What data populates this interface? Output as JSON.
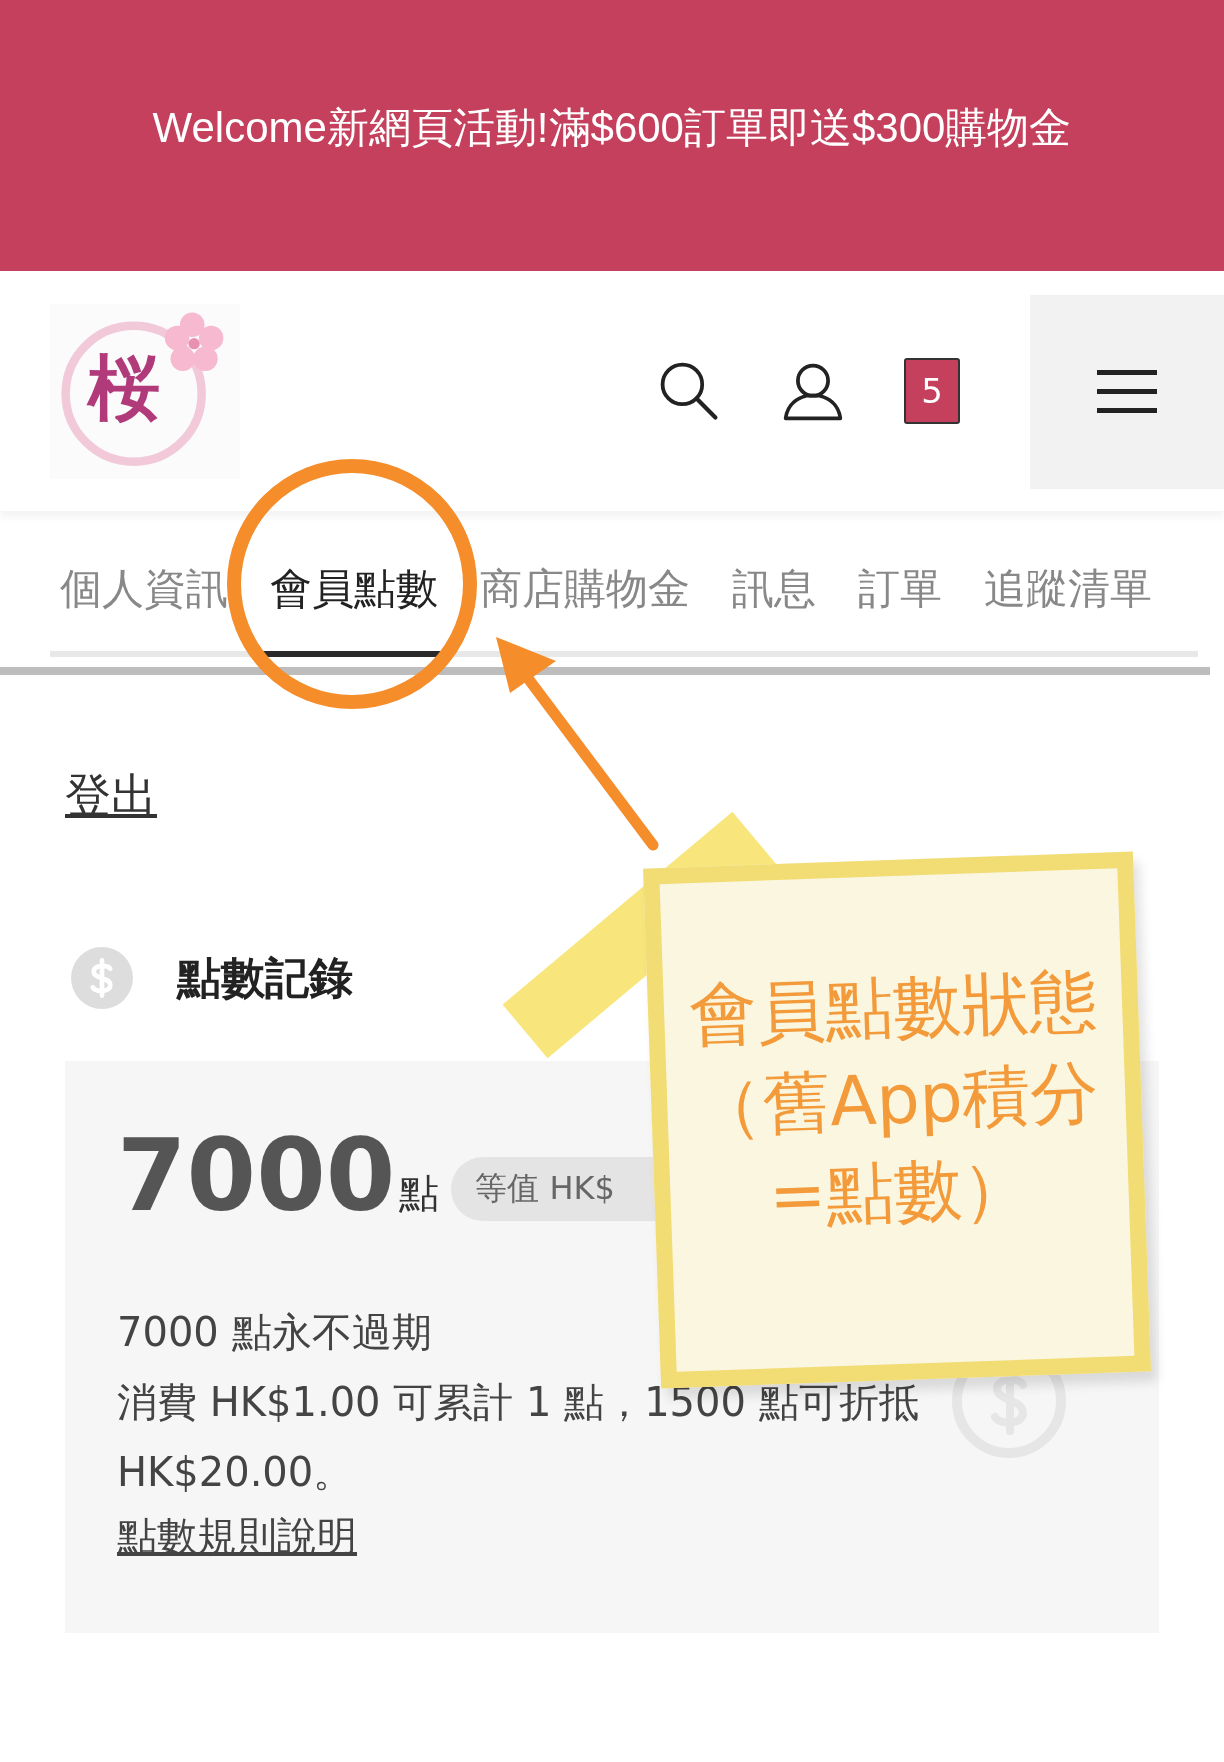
{
  "banner": {
    "text": "Welcome新網頁活動!滿$600訂單即送$300購物金"
  },
  "header": {
    "logo_text": "桜",
    "cart_count": "5"
  },
  "tabs": [
    {
      "label": "個人資訊",
      "selected": false
    },
    {
      "label": "會員點數",
      "selected": true
    },
    {
      "label": "商店購物金",
      "selected": false
    },
    {
      "label": "訊息",
      "selected": false
    },
    {
      "label": "訂單",
      "selected": false
    },
    {
      "label": "追蹤清單",
      "selected": false
    }
  ],
  "logout_link": "登出",
  "points_section": {
    "title": "點數記錄",
    "points": "7000",
    "unit": "點",
    "badge": "等值 HK$",
    "expiry": "7000 點永不過期",
    "rule_text": "消費 HK$1.00 可累計 1 點，1500 點可折抵 HK$20.00。",
    "rules_link": "點數規則說明"
  },
  "annotation": {
    "lines": [
      "會員點數狀態",
      "（舊App積分",
      "=點數）"
    ]
  }
}
